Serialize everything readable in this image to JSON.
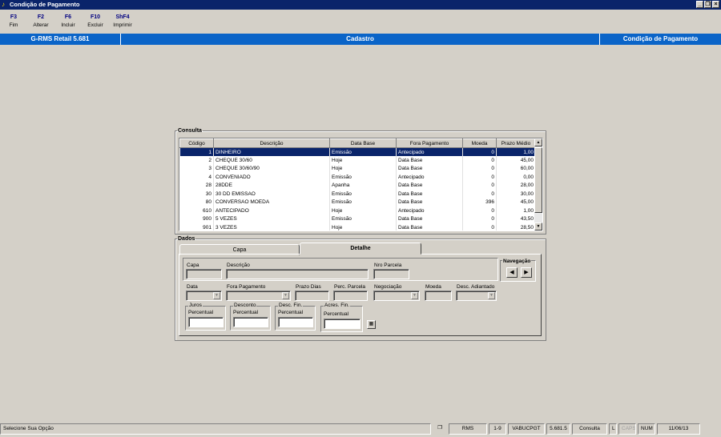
{
  "window": {
    "title": "Condição de Pagamento"
  },
  "fkeys": [
    {
      "key": "F3",
      "label": "Fim"
    },
    {
      "key": "F2",
      "label": "Alterar"
    },
    {
      "key": "F6",
      "label": "Incluir"
    },
    {
      "key": "F10",
      "label": "Excluir"
    },
    {
      "key": "ShF4",
      "label": "Imprimir"
    }
  ],
  "header": {
    "app": "G-RMS Retail 5.681",
    "section": "Cadastro",
    "screen": "Condição de Pagamento"
  },
  "consulta": {
    "legend": "Consulta",
    "columns": [
      "Código",
      "Descrição",
      "Data Base",
      "Fora Pagamento",
      "Moeda",
      "Prazo Médio"
    ],
    "rows": [
      [
        "1",
        "DINHEIRO",
        "Emissão",
        "Antecipado",
        "0",
        "1,00"
      ],
      [
        "2",
        "CHEQUE 30/60",
        "Hoje",
        "Data Base",
        "0",
        "45,00"
      ],
      [
        "3",
        "CHEQUE 30/60/90",
        "Hoje",
        "Data Base",
        "0",
        "60,00"
      ],
      [
        "4",
        "CONVENIADO",
        "Emissão",
        "Antecipado",
        "0",
        "0,00"
      ],
      [
        "28",
        "28DDE",
        "Apanha",
        "Data Base",
        "0",
        "28,00"
      ],
      [
        "30",
        "30 DD EMISSAO",
        "Emissão",
        "Data Base",
        "0",
        "30,00"
      ],
      [
        "80",
        "CONVERSAO MOEDA",
        "Emissão",
        "Data Base",
        "396",
        "45,00"
      ],
      [
        "610",
        "ANTECIPADO",
        "Hoje",
        "Antecipado",
        "0",
        "1,00"
      ],
      [
        "900",
        "5 VEZES",
        "Emissão",
        "Data Base",
        "0",
        "43,50"
      ],
      [
        "901",
        "3 VEZES",
        "Hoje",
        "Data Base",
        "0",
        "28,50"
      ]
    ]
  },
  "dados": {
    "legend": "Dados",
    "tabs": [
      "Capa",
      "Detalhe"
    ],
    "labels": {
      "capa": "Capa",
      "descricao": "Descrição",
      "nro_parcela": "Nro Parcela",
      "navegacao": "Navegação",
      "data": "Data",
      "fora_pagamento": "Fora Pagamento",
      "prazo_dias": "Prazo Dias",
      "perc_parcela": "Perc. Parcela",
      "negociacao": "Negociação",
      "moeda": "Moeda",
      "desc_adiantado": "Desc. Adiantado",
      "juros": "Juros",
      "desconto": "Desconto",
      "desc_fin": "Desc. Fin.",
      "acres_fin": "Acres. Fin.",
      "percentual": "Percentual"
    }
  },
  "status": {
    "message": "Selecione Sua Opção",
    "user": "RMS",
    "page": "1-9",
    "program": "VABUCPGT",
    "version": "5.681.5",
    "mode": "Consulta",
    "l": "L",
    "caps": "CAPS",
    "num": "NUM",
    "date": "11/06/13"
  }
}
